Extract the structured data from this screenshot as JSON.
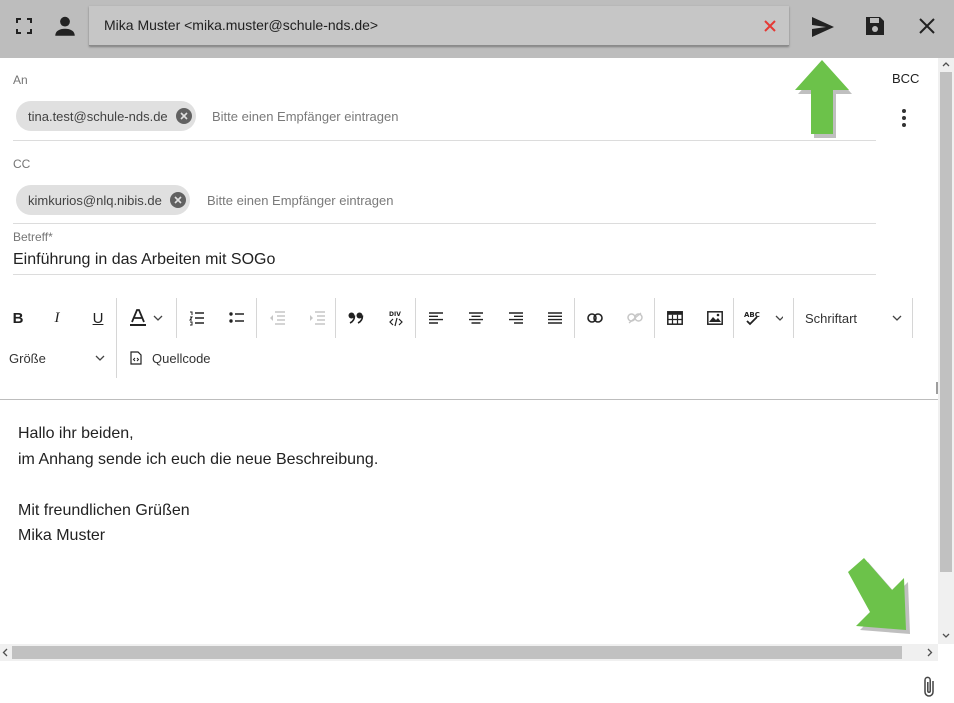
{
  "header": {
    "from_value": "Mika Muster <mika.muster@schule-nds.de>",
    "icons": [
      "fullscreen-icon",
      "person-icon",
      "clear-icon",
      "send-icon",
      "save-icon",
      "close-icon"
    ]
  },
  "recipients": {
    "to_label": "An",
    "to_chips": [
      "tina.test@schule-nds.de"
    ],
    "to_placeholder": "Bitte einen Empfänger eintragen",
    "cc_label": "CC",
    "cc_chips": [
      "kimkurios@nlq.nibis.de"
    ],
    "cc_placeholder": "Bitte einen Empfänger eintragen",
    "bcc_label": "BCC"
  },
  "subject": {
    "label": "Betreff",
    "required_mark": "*",
    "value": "Einführung in das Arbeiten mit SOGo"
  },
  "toolbar": {
    "bold": "B",
    "italic": "I",
    "underline": "U",
    "font_select": "Schriftart",
    "size_select": "Größe",
    "source_label": "Quellcode"
  },
  "message": {
    "lines": [
      "Hallo ihr beiden,",
      "im Anhang sende ich euch die neue Beschreibung.",
      "",
      "Mit freundlichen Grüßen",
      "Mika Muster"
    ]
  },
  "colors": {
    "topbar": "#bdbdbd",
    "arrow_annotation": "#6cc24a",
    "clear_icon": "#e53935"
  }
}
